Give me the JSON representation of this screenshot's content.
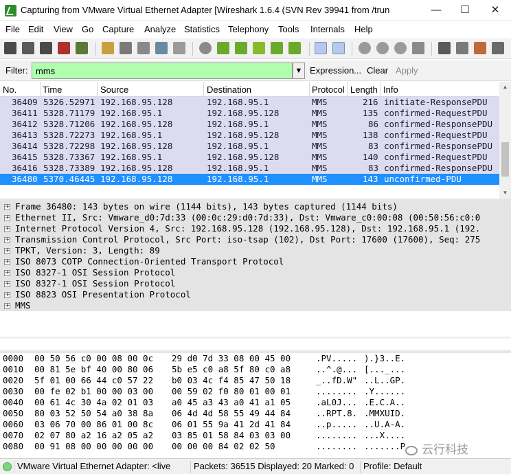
{
  "window": {
    "title": "Capturing from VMware Virtual Ethernet Adapter   [Wireshark 1.6.4  (SVN Rev 39941 from /trun",
    "minimize": "—",
    "maximize": "☐",
    "close": "✕"
  },
  "menu": [
    "File",
    "Edit",
    "View",
    "Go",
    "Capture",
    "Analyze",
    "Statistics",
    "Telephony",
    "Tools",
    "Internals",
    "Help"
  ],
  "toolbar": {
    "icons": [
      "interface-list-icon",
      "capture-options-icon",
      "start-capture-icon",
      "stop-capture-icon",
      "restart-capture-icon",
      "open-file-icon",
      "save-file-icon",
      "close-file-icon",
      "reload-icon",
      "print-icon",
      "find-packet-icon",
      "go-back-icon",
      "go-forward-icon",
      "go-to-packet-icon",
      "go-first-icon",
      "go-last-icon",
      "colorize-icon",
      "auto-scroll-icon",
      "zoom-in-icon",
      "zoom-out-icon",
      "zoom-normal-icon",
      "resize-columns-icon",
      "capture-filters-icon",
      "display-filters-icon",
      "coloring-rules-icon",
      "preferences-icon",
      "help-icon"
    ]
  },
  "filter": {
    "label": "Filter:",
    "value": "mms",
    "expression": "Expression...",
    "clear": "Clear",
    "apply": "Apply",
    "bg_color": "#afffaf"
  },
  "packet_list": {
    "columns": [
      "No.",
      "Time",
      "Source",
      "Destination",
      "Protocol",
      "Length",
      "Info"
    ],
    "rows": [
      {
        "no": "36409",
        "time": "5326.52971",
        "src": "192.168.95.128",
        "dst": "192.168.95.1",
        "proto": "MMS",
        "len": "216",
        "info": "initiate-ResponsePDU"
      },
      {
        "no": "36411",
        "time": "5328.71179",
        "src": "192.168.95.1",
        "dst": "192.168.95.128",
        "proto": "MMS",
        "len": "135",
        "info": "confirmed-RequestPDU"
      },
      {
        "no": "36412",
        "time": "5328.71206",
        "src": "192.168.95.128",
        "dst": "192.168.95.1",
        "proto": "MMS",
        "len": "86",
        "info": "confirmed-ResponsePDU"
      },
      {
        "no": "36413",
        "time": "5328.72273",
        "src": "192.168.95.1",
        "dst": "192.168.95.128",
        "proto": "MMS",
        "len": "138",
        "info": "confirmed-RequestPDU"
      },
      {
        "no": "36414",
        "time": "5328.72298",
        "src": "192.168.95.128",
        "dst": "192.168.95.1",
        "proto": "MMS",
        "len": "83",
        "info": "confirmed-ResponsePDU"
      },
      {
        "no": "36415",
        "time": "5328.73367",
        "src": "192.168.95.1",
        "dst": "192.168.95.128",
        "proto": "MMS",
        "len": "140",
        "info": "confirmed-RequestPDU"
      },
      {
        "no": "36416",
        "time": "5328.73389",
        "src": "192.168.95.128",
        "dst": "192.168.95.1",
        "proto": "MMS",
        "len": "83",
        "info": "confirmed-ResponsePDU"
      },
      {
        "no": "36480",
        "time": "5370.46445",
        "src": "192.168.95.128",
        "dst": "192.168.95.1",
        "proto": "MMS",
        "len": "143",
        "info": "unconfirmed-PDU"
      }
    ],
    "row_color": "#dcdcf0",
    "selected_color": "#1e90ff"
  },
  "details": [
    "Frame 36480: 143 bytes on wire (1144 bits), 143 bytes captured (1144 bits)",
    "Ethernet II, Src: Vmware_d0:7d:33 (00:0c:29:d0:7d:33), Dst: Vmware_c0:00:08 (00:50:56:c0:0",
    "Internet Protocol Version 4, Src: 192.168.95.128 (192.168.95.128), Dst: 192.168.95.1 (192.",
    "Transmission Control Protocol, Src Port: iso-tsap (102), Dst Port: 17600 (17600), Seq: 275",
    "TPKT, Version: 3, Length: 89",
    "ISO 8073 COTP Connection-Oriented Transport Protocol",
    "ISO 8327-1 OSI Session Protocol",
    "ISO 8327-1 OSI Session Protocol",
    "ISO 8823 OSI Presentation Protocol",
    "MMS"
  ],
  "expand_glyph": "+",
  "hexdump": [
    {
      "offset": "0000",
      "hex1": "00 50 56 c0 00 08 00 0c",
      "hex2": "29 d0 7d 33 08 00 45 00",
      "ascii1": ".PV.....",
      "ascii2": ").}3..E."
    },
    {
      "offset": "0010",
      "hex1": "00 81 5e bf 40 00 80 06",
      "hex2": "5b e5 c0 a8 5f 80 c0 a8",
      "ascii1": "..^.@...",
      "ascii2": "[..._..."
    },
    {
      "offset": "0020",
      "hex1": "5f 01 00 66 44 c0 57 22",
      "hex2": "b0 03 4c f4 85 47 50 18",
      "ascii1": "_..fD.W\"",
      "ascii2": "..L..GP."
    },
    {
      "offset": "0030",
      "hex1": "00 fe 02 b1 00 00 03 00",
      "hex2": "00 59 02 f0 80 01 00 01",
      "ascii1": "........",
      "ascii2": ".Y......"
    },
    {
      "offset": "0040",
      "hex1": "00 61 4c 30 4a 02 01 03",
      "hex2": "a0 45 a3 43 a0 41 a1 05",
      "ascii1": ".aL0J...",
      "ascii2": ".E.C.A.."
    },
    {
      "offset": "0050",
      "hex1": "80 03 52 50 54 a0 38 8a",
      "hex2": "06 4d 4d 58 55 49 44 84",
      "ascii1": "..RPT.8.",
      "ascii2": ".MMXUID."
    },
    {
      "offset": "0060",
      "hex1": "03 06 70 00 86 01 00 8c",
      "hex2": "06 01 55 9a 41 2d 41 84",
      "ascii1": "..p.....",
      "ascii2": "..U.A-A."
    },
    {
      "offset": "0070",
      "hex1": "02 07 80 a2 16 a2 05 a2",
      "hex2": "03 85 01 58 84 03 03 00",
      "ascii1": "........",
      "ascii2": "...X...."
    },
    {
      "offset": "0080",
      "hex1": "00 91 08 00 00 00 00 00",
      "hex2": "00 00 00 84 02 02 50",
      "ascii1": "........",
      "ascii2": ".......P"
    }
  ],
  "watermark": "云行科技",
  "status": {
    "adapter": "VMware Virtual Ethernet Adapter: <live",
    "packets": "Packets: 36515 Displayed: 20 Marked: 0",
    "profile": "Profile: Default"
  }
}
